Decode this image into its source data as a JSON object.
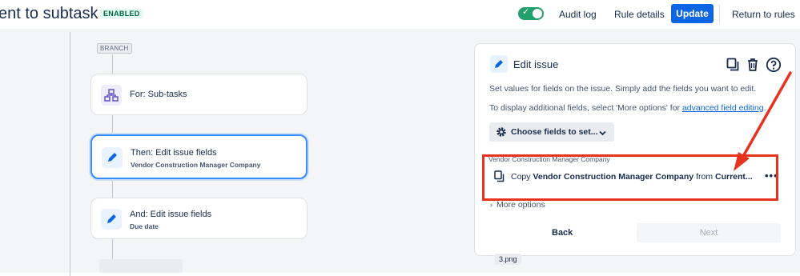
{
  "header": {
    "title": "ent to subtask",
    "status_badge": "ENABLED",
    "audit_log": "Audit log",
    "rule_details": "Rule details",
    "update": "Update",
    "return_to_rules": "Return to rules"
  },
  "flow": {
    "branch_label": "BRANCH",
    "nodes": [
      {
        "title": "For: Sub-tasks",
        "subtitle": "",
        "icon": "hierarchy-icon"
      },
      {
        "title": "Then: Edit issue fields",
        "subtitle": "Vendor Construction Manager Company",
        "icon": "pencil-icon"
      },
      {
        "title": "And: Edit issue fields",
        "subtitle": "Due date",
        "icon": "pencil-icon"
      }
    ]
  },
  "panel": {
    "title": "Edit issue",
    "description": "Set values for fields on the issue. Simply add the fields you want to edit.",
    "additional_prefix": "To display additional fields, select 'More options' for ",
    "additional_link": "advanced field editing",
    "additional_suffix": ".",
    "choose_fields": "Choose fields to set...",
    "field_label": "Vendor Construction Manager Company",
    "field_copy": "Copy",
    "field_name": "Vendor Construction Manager Company",
    "field_from": "from",
    "field_source": "Current...",
    "more_options": "More options",
    "back": "Back",
    "next": "Next"
  },
  "annotation": {
    "file_name": "3.png",
    "color": "#e5331f"
  },
  "colors": {
    "primary": "#0c66e4",
    "toggle": "#22a06b",
    "selected_border": "#388bff"
  }
}
